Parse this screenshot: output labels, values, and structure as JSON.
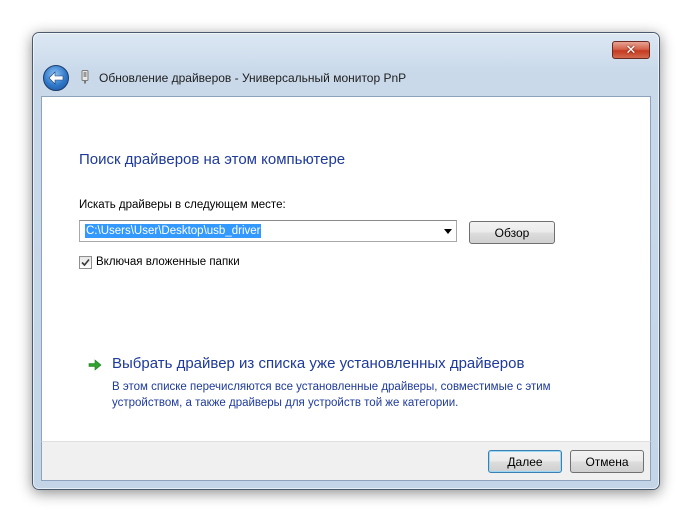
{
  "window": {
    "title": "Обновление драйверов - Универсальный монитор PnP",
    "close_glyph": "✕"
  },
  "content": {
    "heading": "Поиск драйверов на этом компьютере",
    "search_label": "Искать драйверы в следующем месте:",
    "path_value": "C:\\Users\\User\\Desktop\\usb_driver",
    "browse_label": "Обзор",
    "include_subfolders": {
      "label": "Включая вложенные папки",
      "checked": true
    },
    "pick_link": {
      "title": "Выбрать драйвер из списка уже установленных драйверов",
      "description": "В этом списке перечисляются все установленные драйверы, совместимые с этим устройством, а также драйверы для устройств той же категории."
    }
  },
  "footer": {
    "next_label": "Далее",
    "cancel_label": "Отмена"
  },
  "icons": {
    "back": "back-arrow-icon",
    "device": "device-icon",
    "link_arrow": "green-arrow-icon",
    "checkmark": "checkmark-icon"
  },
  "colors": {
    "link_blue": "#1e3a9b",
    "selection": "#3399ff",
    "link_arrow_green": "#2ea42e"
  }
}
